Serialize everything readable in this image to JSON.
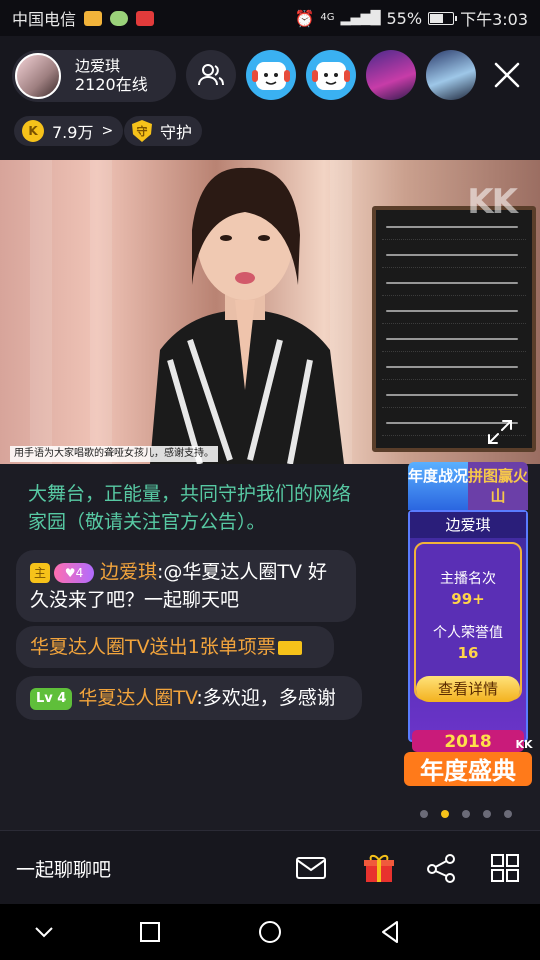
{
  "status_bar": {
    "carrier": "中国电信",
    "network": "4G",
    "battery": "55%",
    "time": "下午3:03"
  },
  "header": {
    "host_name": "边爱琪",
    "online_count": "2120在线",
    "coins": "7.9万",
    "guard_label": "守护"
  },
  "video": {
    "watermark": "KK",
    "caption": "用手语为大家唱歌的聋哑女孩儿，感谢支持。"
  },
  "chat": {
    "notice": "大舞台，正能量，共同守护我们的网络家园（敬请关注官方公告）。",
    "messages": [
      {
        "badge_k": "主",
        "heart_level": "4",
        "sender": "边爱琪",
        "text": ":@华夏达人圈TV 好久没来了吧？一起聊天吧"
      },
      {
        "text": "华夏达人圈TV送出1张单项票"
      },
      {
        "level": "Lv 4",
        "sender": "华夏达人圈TV",
        "text": ":多欢迎，多感谢"
      }
    ]
  },
  "event": {
    "tab_1": "年度战况",
    "tab_2": "拼图赢火山",
    "host_name": "边爱琪",
    "rank_label": "主播名次",
    "rank_value": "99+",
    "honor_label": "个人荣誉值",
    "honor_value": "16",
    "detail_button": "查看详情",
    "banner_year": "2018",
    "banner_brand": "KK",
    "banner_title": "年度盛典"
  },
  "bottom_bar": {
    "input_placeholder": "一起聊聊吧"
  }
}
